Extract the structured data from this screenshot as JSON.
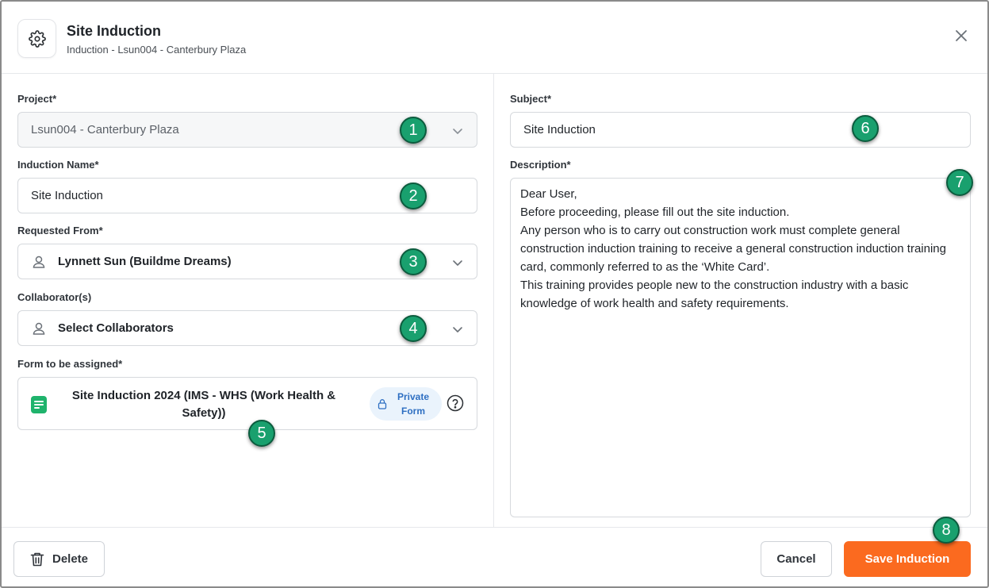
{
  "header": {
    "title": "Site Induction",
    "subtitle": "Induction - Lsun004 - Canterbury Plaza"
  },
  "project": {
    "label": "Project*",
    "value": "Lsun004 - Canterbury Plaza"
  },
  "induction_name": {
    "label": "Induction Name*",
    "value": "Site Induction"
  },
  "requested_from": {
    "label": "Requested From*",
    "value": "Lynnett Sun (Buildme Dreams)"
  },
  "collaborators": {
    "label": "Collaborator(s)",
    "placeholder": "Select Collaborators"
  },
  "form": {
    "label": "Form to be assigned*",
    "name": "Site Induction 2024 (IMS - WHS (Work Health & Safety))",
    "badge_line1": "Private",
    "badge_line2": "Form"
  },
  "subject": {
    "label": "Subject*",
    "value": "Site Induction"
  },
  "description": {
    "label": "Description*",
    "lines": [
      "Dear User,",
      "Before proceeding, please fill out the site induction.",
      "Any person who is to carry out construction work must complete general construction induction training to receive a general construction induction training card, commonly referred to as the ‘White Card’.",
      "This training provides people new to the construction industry with a basic knowledge of work health and safety requirements."
    ]
  },
  "footer": {
    "delete_label": "Delete",
    "cancel_label": "Cancel",
    "save_label": "Save Induction"
  },
  "callouts": [
    "1",
    "2",
    "3",
    "4",
    "5",
    "6",
    "7",
    "8"
  ],
  "colors": {
    "primary": "#fb6a1f",
    "badge_bg": "#eaf3fc",
    "badge_text": "#2e6fc2",
    "form_icon": "#1fb36c",
    "callout": "#19a06e"
  }
}
